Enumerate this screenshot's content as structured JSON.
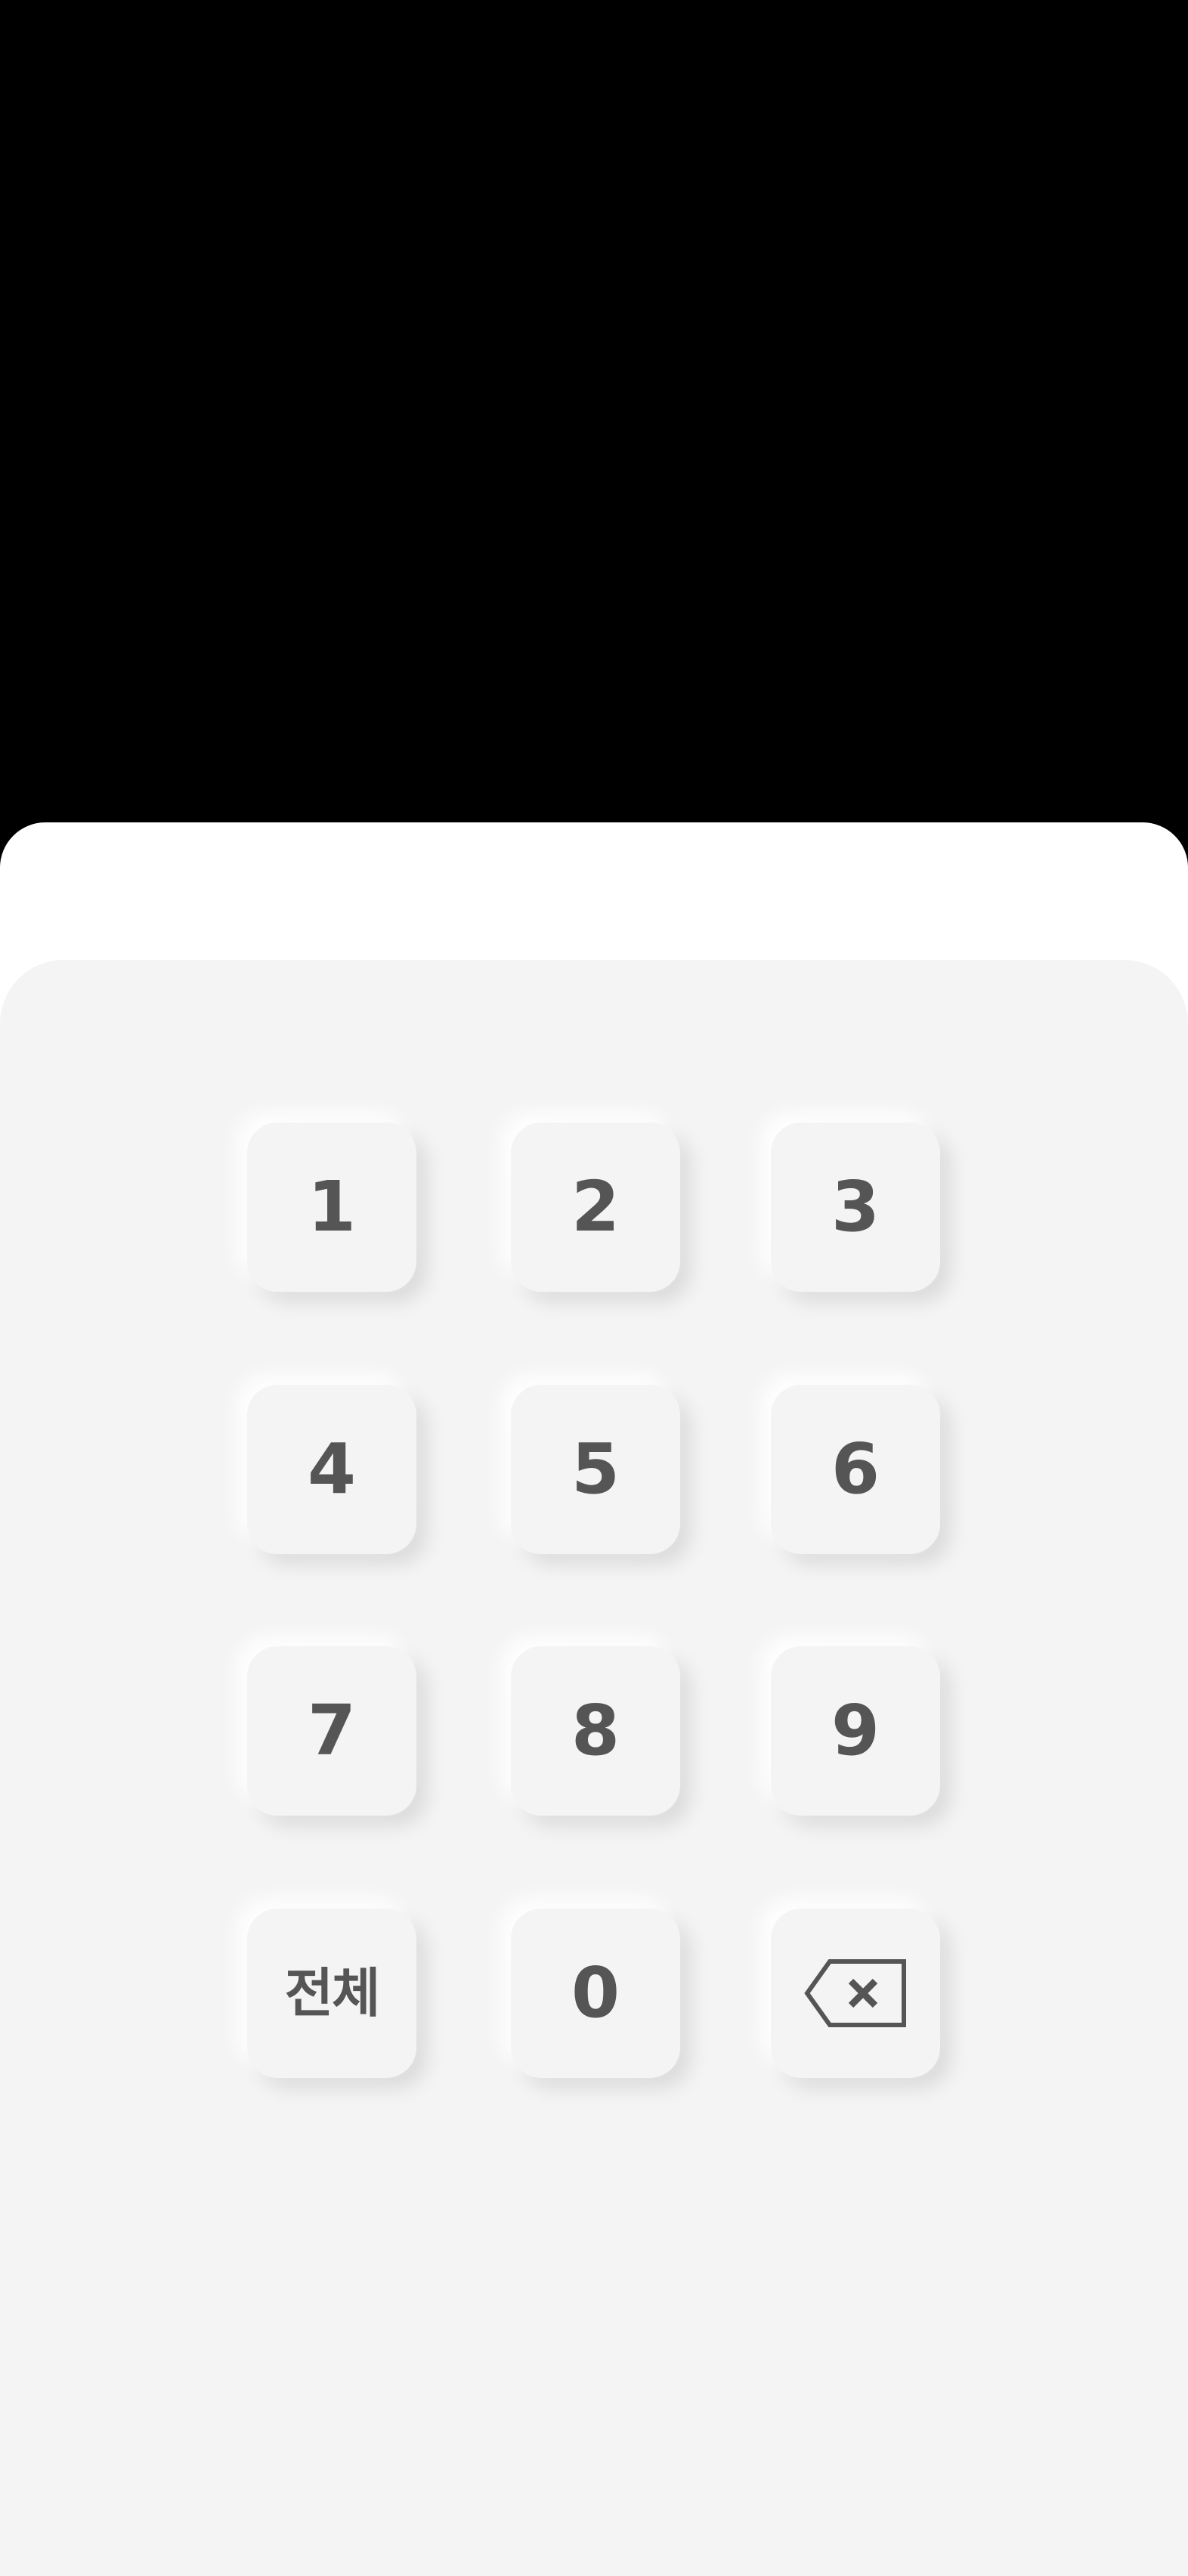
{
  "keypad": {
    "keys": {
      "k1": "1",
      "k2": "2",
      "k3": "3",
      "k4": "4",
      "k5": "5",
      "k6": "6",
      "k7": "7",
      "k8": "8",
      "k9": "9",
      "all": "전체",
      "k0": "0",
      "backspace_icon": "backspace-icon"
    },
    "colors": {
      "panel_background": "#f4f4f4",
      "key_text": "#555555",
      "top_background": "#000000",
      "sheet_background": "#ffffff"
    }
  }
}
